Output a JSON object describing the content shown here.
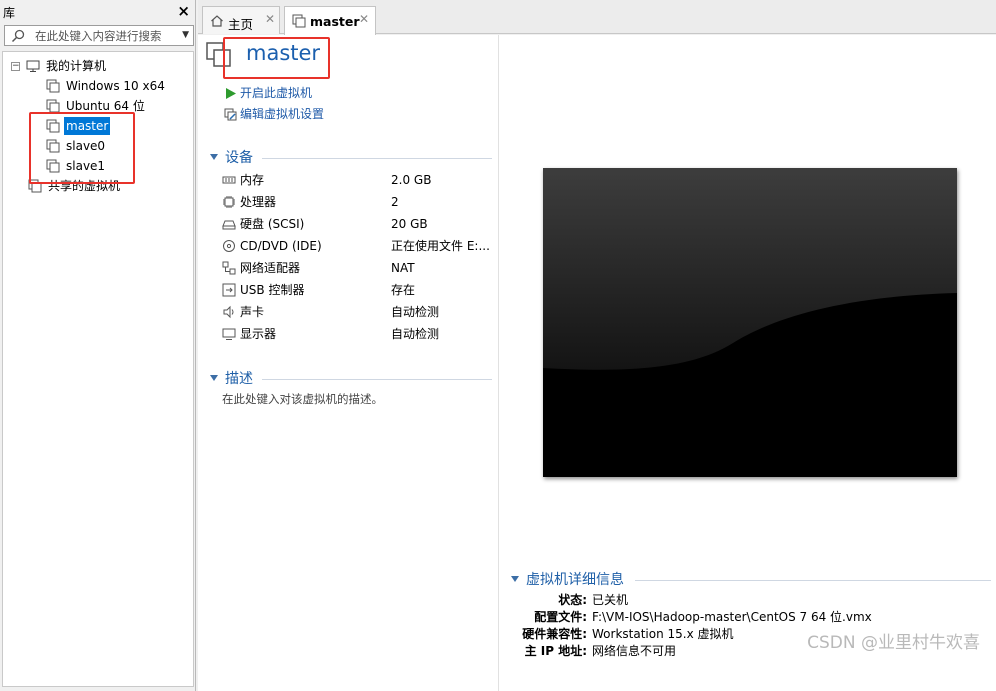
{
  "library": {
    "title": "库",
    "search_placeholder": "在此处键入内容进行搜索",
    "tree": {
      "root": "我的计算机",
      "vms": [
        "Windows 10 x64",
        "Ubuntu 64 位",
        "master",
        "slave0",
        "slave1"
      ],
      "selected": "master",
      "shared": "共享的虚拟机"
    }
  },
  "tabs": [
    {
      "label": "主页",
      "icon": "home-icon"
    },
    {
      "label": "master",
      "icon": "vm-icon",
      "active": true
    }
  ],
  "vm": {
    "name": "master",
    "actions": [
      "开启此虚拟机",
      "编辑虚拟机设置"
    ],
    "devices_heading": "设备",
    "devices": [
      {
        "name": "内存",
        "value": "2.0 GB",
        "icon": "memory-icon"
      },
      {
        "name": "处理器",
        "value": "2",
        "icon": "cpu-icon"
      },
      {
        "name": "硬盘 (SCSI)",
        "value": "20 GB",
        "icon": "harddisk-icon"
      },
      {
        "name": "CD/DVD (IDE)",
        "value": "正在使用文件 E:...",
        "icon": "cdrom-icon"
      },
      {
        "name": "网络适配器",
        "value": "NAT",
        "icon": "network-icon"
      },
      {
        "name": "USB 控制器",
        "value": "存在",
        "icon": "usb-icon"
      },
      {
        "name": "声卡",
        "value": "自动检测",
        "icon": "sound-icon"
      },
      {
        "name": "显示器",
        "value": "自动检测",
        "icon": "display-icon"
      }
    ],
    "description_heading": "描述",
    "description_placeholder": "在此处键入对该虚拟机的描述。",
    "details_heading": "虚拟机详细信息",
    "details": [
      {
        "key": "状态:",
        "value": "已关机"
      },
      {
        "key": "配置文件:",
        "value": "F:\\VM-IOS\\Hadoop-master\\CentOS 7 64 位.vmx"
      },
      {
        "key": "硬件兼容性:",
        "value": "Workstation 15.x 虚拟机"
      },
      {
        "key": "主 IP 地址:",
        "value": "网络信息不可用"
      }
    ]
  },
  "colors": {
    "accent": "#1b5fae",
    "selection": "#0078d7",
    "highlight_box": "#e8322a",
    "power_green": "#2e9b2e"
  },
  "watermark": "CSDN @业里村牛欢喜"
}
